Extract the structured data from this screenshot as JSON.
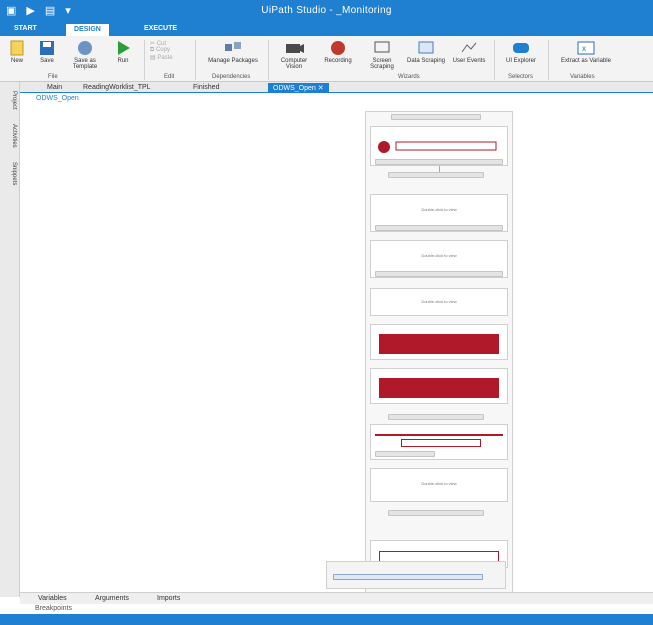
{
  "window": {
    "title": "UiPath Studio - _Monitoring",
    "accent": "#1f7fd1",
    "error_red": "#b0192a"
  },
  "ribbon_tabs": [
    {
      "label": "START"
    },
    {
      "label": "DESIGN"
    },
    {
      "label": "EXECUTE"
    }
  ],
  "ribbon": {
    "new": "New",
    "save": "Save",
    "save_as_template": "Save as Template",
    "run": "Run",
    "cut": "Cut",
    "copy": "Copy",
    "paste": "Paste",
    "manage_packages": "Manage Packages",
    "computer_vision": "Computer Vision",
    "recording": "Recording",
    "screen_scraping": "Screen Scraping",
    "data_scraping": "Data Scraping",
    "user_events": "User Events",
    "ui_explorer": "UI Explorer",
    "extract_as_variable": "Extract as Variable",
    "groups": {
      "file": "File",
      "edit": "Edit",
      "dependencies": "Dependencies",
      "wizards": "Wizards",
      "selectors": "Selectors",
      "variables": "Variables"
    }
  },
  "document_tabs": [
    {
      "label": "Main"
    },
    {
      "label": "ReadingWorklist_TPL"
    },
    {
      "label": "Finished"
    },
    {
      "label": "ODWS_Open"
    }
  ],
  "breadcrumb": "ODWS_Open",
  "side_panel": [
    "Project",
    "Activities",
    "Snippets"
  ],
  "canvas": {
    "placeholder_text": "Double-click to view"
  },
  "bottom_tabs": [
    "Variables",
    "Arguments",
    "Imports"
  ],
  "breakpoints_label": "Breakpoints"
}
